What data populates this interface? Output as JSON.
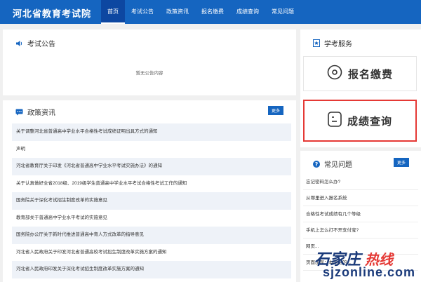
{
  "header": {
    "logo": "河北省教育考试院",
    "nav": [
      "首页",
      "考试公告",
      "政策资讯",
      "报名缴费",
      "成绩查询",
      "常见问题"
    ]
  },
  "announcement": {
    "title": "考试公告",
    "empty_text": "暂无公告内容"
  },
  "policy": {
    "title": "政策资讯",
    "more": "更多",
    "items": [
      "关于调整河北省普通高中学业水平合格性考试成绩证明出具方式的通知",
      "声明",
      "河北省教育厅关于印发《河北省普通高中学业水平考试实施办法》的通知",
      "关于认真做好全省2018级、2019级学生普通高中学业水平考试合格性考试工作的通知",
      "国务院关于深化考试招生制度改革的实施意见",
      "教育部关于普通高中学业水平考试的实施意见",
      "国务院办公厅关于新时代推进普通高中育人方式改革的指导意见",
      "河北省人民政府关于印发河北省普通高校考试招生制度改革实施方案的通知",
      "河北省人民政府印发关于深化考试招生制度改革实施方案的通知"
    ]
  },
  "service": {
    "title": "学考服务",
    "pay": "报名缴费",
    "score": "成绩查询"
  },
  "faq": {
    "title": "常见问题",
    "more": "更多",
    "items": [
      "忘记密码怎么办?",
      "从哪里进入报名系统",
      "合格性考试成绩有几个等级",
      "手机上怎么打不开支付宝?",
      "网页...",
      "页面出现：本网站的..."
    ]
  },
  "watermark": {
    "line1": "石家庄",
    "line1_red": "热线",
    "line2": "sjzonline.com"
  },
  "colors": {
    "primary": "#1565c0",
    "highlight": "#e53935"
  }
}
